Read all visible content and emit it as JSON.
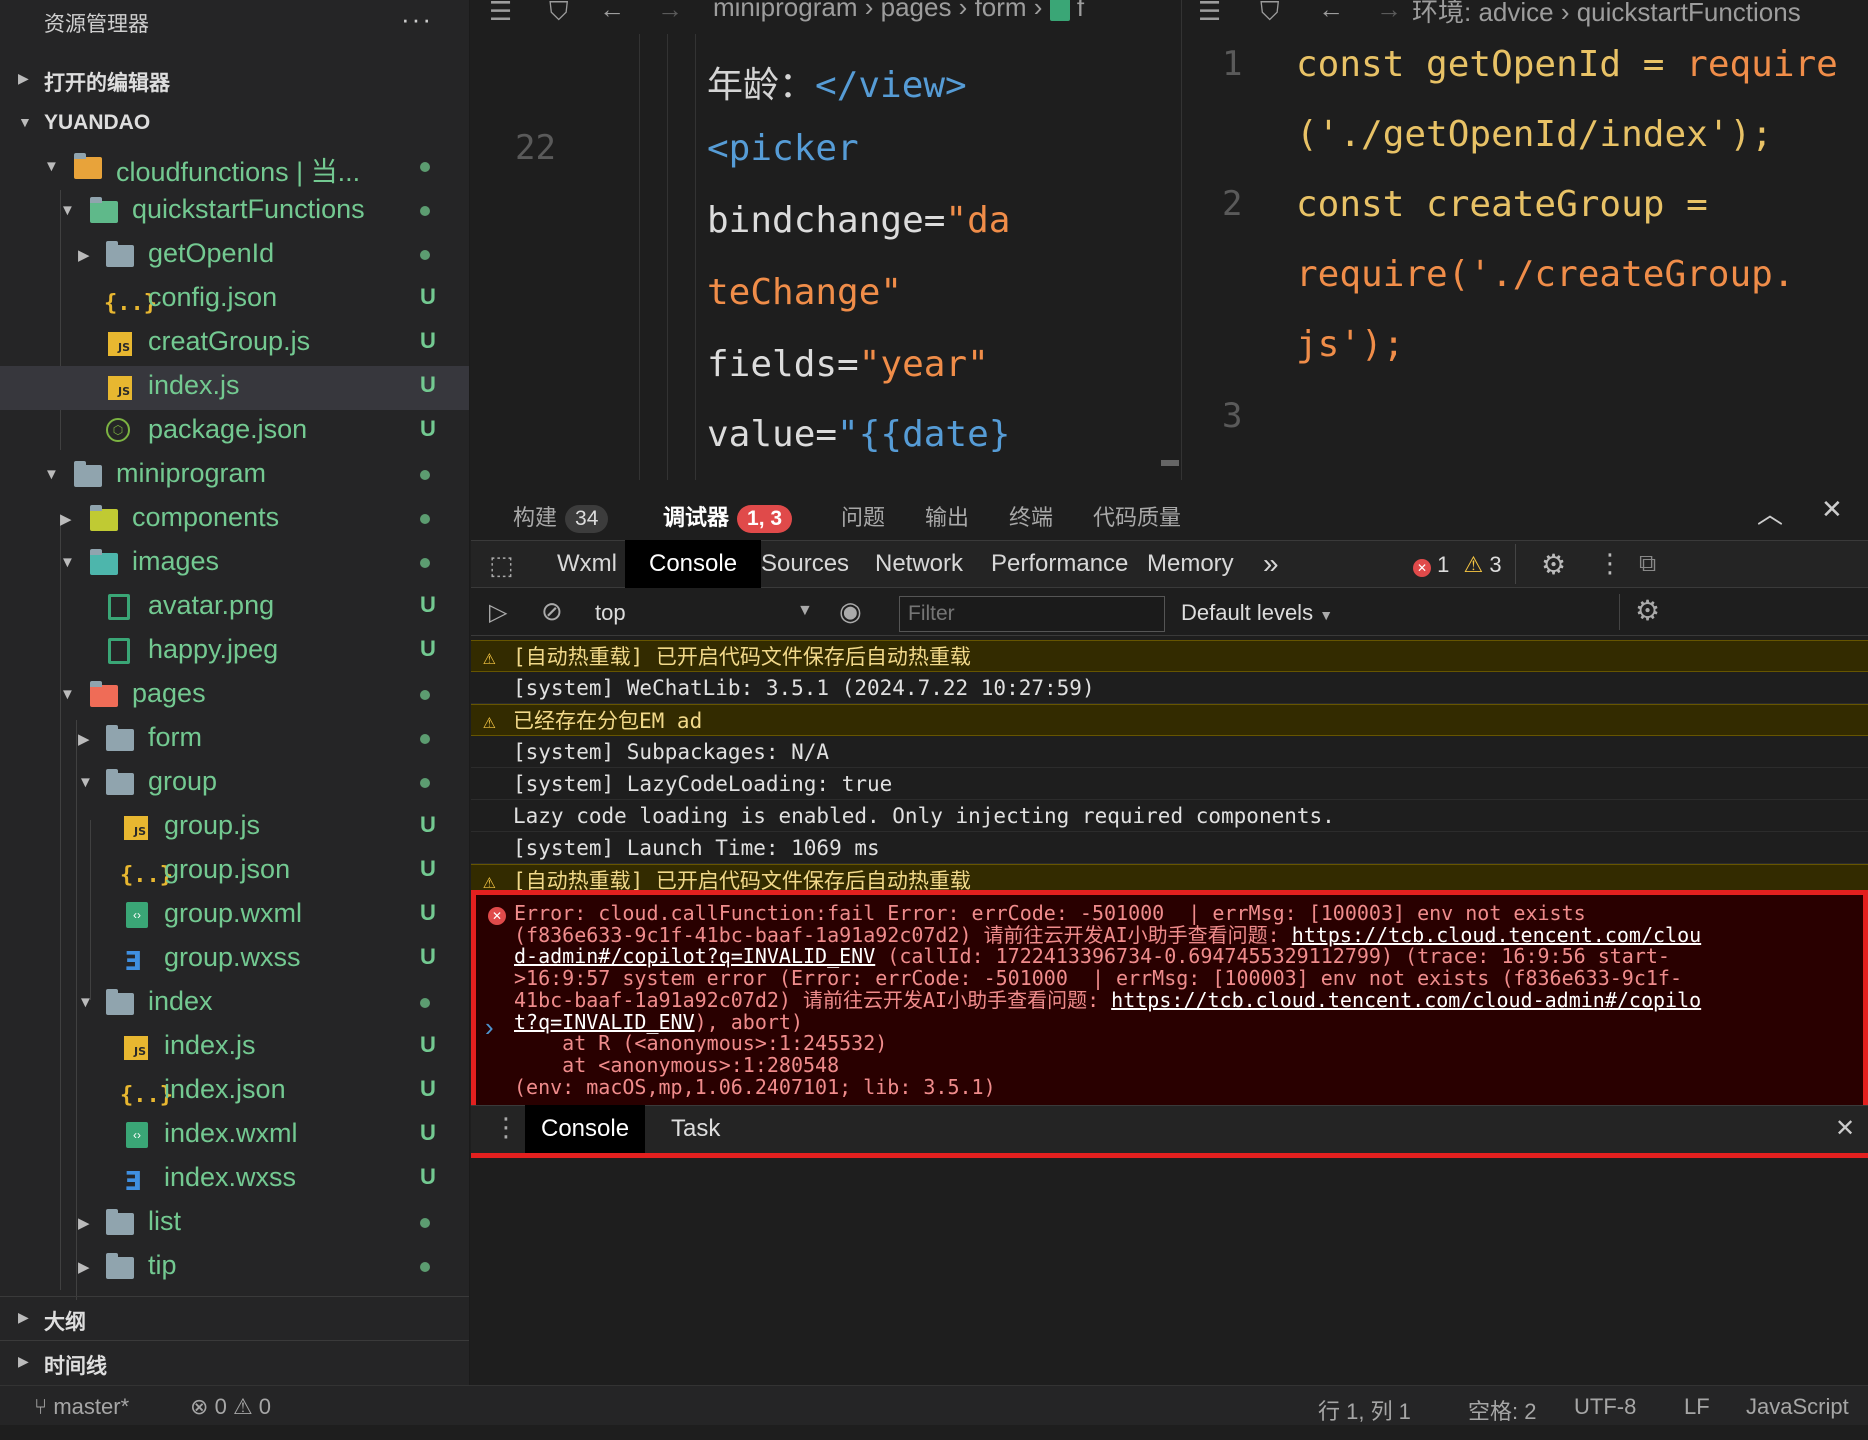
{
  "sidebar": {
    "title": "资源管理器",
    "more": "···",
    "open_editors": "打开的编辑器",
    "project": "YUANDAO",
    "tree": [
      {
        "name": "cloudfunctions | 当...",
        "status": "●"
      },
      {
        "name": "quickstartFunctions",
        "status": "●"
      },
      {
        "name": "getOpenId",
        "status": "●"
      },
      {
        "name": "config.json",
        "status": "U"
      },
      {
        "name": "creatGroup.js",
        "status": "U"
      },
      {
        "name": "index.js",
        "status": "U"
      },
      {
        "name": "package.json",
        "status": "U"
      },
      {
        "name": "miniprogram",
        "status": "●"
      },
      {
        "name": "components",
        "status": "●"
      },
      {
        "name": "images",
        "status": "●"
      },
      {
        "name": "avatar.png",
        "status": "U"
      },
      {
        "name": "happy.jpeg",
        "status": "U"
      },
      {
        "name": "pages",
        "status": "●"
      },
      {
        "name": "form",
        "status": "●"
      },
      {
        "name": "group",
        "status": "●"
      },
      {
        "name": "group.js",
        "status": "U"
      },
      {
        "name": "group.json",
        "status": "U"
      },
      {
        "name": "group.wxml",
        "status": "U"
      },
      {
        "name": "group.wxss",
        "status": "U"
      },
      {
        "name": "index",
        "status": "●"
      },
      {
        "name": "index.js",
        "status": "U"
      },
      {
        "name": "index.json",
        "status": "U"
      },
      {
        "name": "index.wxml",
        "status": "U"
      },
      {
        "name": "index.wxss",
        "status": "U"
      },
      {
        "name": "list",
        "status": "●"
      },
      {
        "name": "tip",
        "status": "●"
      }
    ],
    "outline": "大纲",
    "timeline": "时间线"
  },
  "editor_left": {
    "breadcrumb": [
      "miniprogram",
      "pages",
      "form",
      "f"
    ],
    "line_number": "22",
    "lines": [
      {
        "a": "年龄：",
        "b": "</view>"
      },
      {
        "a": "<picker",
        "b": ""
      },
      {
        "a": "bindchange=",
        "b": "\"da"
      },
      {
        "a": "teChange\"",
        "b": ""
      },
      {
        "a": "fields=",
        "b": "\"year\""
      },
      {
        "a": "value=",
        "b": "\"{{date}"
      }
    ]
  },
  "editor_right": {
    "breadcrumb": [
      "环境: advice",
      "quickstartFunctions"
    ],
    "line_numbers": [
      "1",
      "2",
      "3"
    ],
    "code": {
      "l1a": "const getOpenId = ",
      "l1b": "require",
      "l1c": "('./getOpenId/index');",
      "l2a": "const createGroup =",
      "l2b": "require('./createGroup.",
      "l2c": "js');"
    }
  },
  "panel": {
    "tabs": [
      {
        "label": "构建",
        "badge": "34"
      },
      {
        "label": "调试器",
        "badge": "1, 3"
      },
      {
        "label": "问题",
        "badge": ""
      },
      {
        "label": "输出",
        "badge": ""
      },
      {
        "label": "终端",
        "badge": ""
      },
      {
        "label": "代码质量",
        "badge": ""
      }
    ],
    "devtools_tabs": [
      "Wxml",
      "Console",
      "Sources",
      "Network",
      "Performance",
      "Memory",
      "»"
    ],
    "error_count": "1",
    "warn_count": "3",
    "context": "top",
    "filter_placeholder": "Filter",
    "levels": "Default levels",
    "console_lines": [
      {
        "type": "warn",
        "text": "[自动热重载] 已开启代码文件保存后自动热重载"
      },
      {
        "type": "norm",
        "text": "[system] WeChatLib: 3.5.1 (2024.7.22 10:27:59)"
      },
      {
        "type": "warn",
        "text": "已经存在分包EM ad"
      },
      {
        "type": "norm",
        "text": "[system] Subpackages: N/A"
      },
      {
        "type": "norm",
        "text": "[system] LazyCodeLoading: true"
      },
      {
        "type": "norm",
        "text": "Lazy code loading is enabled. Only injecting required components."
      },
      {
        "type": "norm",
        "text": "[system] Launch Time: 1069 ms"
      },
      {
        "type": "warn",
        "text": "[自动热重载] 已开启代码文件保存后自动热重载"
      }
    ],
    "error": {
      "l1": "Error: cloud.callFunction:fail Error: errCode: -501000  | errMsg: [100003] env not exists",
      "l2a": "(f836e633-9c1f-41bc-baaf-1a91a92c07d2) 请前往云开发AI小助手查看问题: ",
      "l2link": "https://tcb.cloud.tencent.com/clou",
      "l3link": "d-admin#/copilot?q=INVALID_ENV",
      "l3b": " (callId: 1722413396734-0.6947455329112799) (trace: 16:9:56 start-",
      "l4": ">16:9:57 system error (Error: errCode: -501000  | errMsg: [100003] env not exists (f836e633-9c1f-",
      "l5a": "41bc-baaf-1a91a92c07d2) 请前往云开发AI小助手查看问题: ",
      "l5link": "https://tcb.cloud.tencent.com/cloud-admin#/copilo",
      "l6link": "t?q=INVALID_ENV",
      "l6b": "), abort)",
      "l7": "    at R (<anonymous>:1:245532)",
      "l8": "    at <anonymous>:1:280548",
      "l9": "(env: macOS,mp,1.06.2407101; lib: 3.5.1)"
    },
    "prompt": "›",
    "drawer_tabs": [
      "Console",
      "Task"
    ]
  },
  "statusbar": {
    "branch": "master*",
    "errors": "0",
    "warnings": "0",
    "position": "行 1, 列 1",
    "spaces": "空格: 2",
    "encoding": "UTF-8",
    "eol": "LF",
    "language": "JavaScript"
  },
  "colors": {
    "accent": "#73c991",
    "error_border": "#e3201f",
    "warning_bg": "#332b00"
  }
}
